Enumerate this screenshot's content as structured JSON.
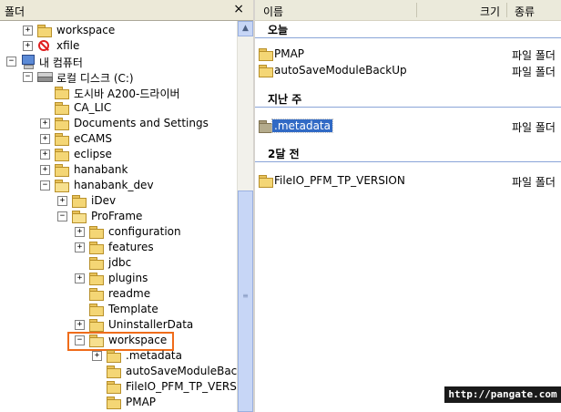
{
  "left_pane": {
    "title": "폴더",
    "close_glyph": "×",
    "tree": [
      {
        "label": "workspace",
        "expander": "+",
        "icon": "folder-icon"
      },
      {
        "label": "xfile",
        "expander": "+",
        "icon": "blocked-icon"
      },
      {
        "label": "내 컴퓨터",
        "expander": "−",
        "icon": "computer-icon"
      },
      {
        "label": "로컬 디스크 (C:)",
        "expander": "−",
        "icon": "drive-icon"
      },
      {
        "label": "도시바 A200-드라이버",
        "expander": "",
        "icon": "folder-icon"
      },
      {
        "label": "CA_LIC",
        "expander": "",
        "icon": "folder-icon"
      },
      {
        "label": "Documents and Settings",
        "expander": "+",
        "icon": "folder-icon"
      },
      {
        "label": "eCAMS",
        "expander": "+",
        "icon": "folder-icon"
      },
      {
        "label": "eclipse",
        "expander": "+",
        "icon": "folder-icon"
      },
      {
        "label": "hanabank",
        "expander": "+",
        "icon": "folder-icon"
      },
      {
        "label": "hanabank_dev",
        "expander": "−",
        "icon": "folder-icon"
      },
      {
        "label": "iDev",
        "expander": "+",
        "icon": "folder-icon"
      },
      {
        "label": "ProFrame",
        "expander": "−",
        "icon": "folder-icon"
      },
      {
        "label": "configuration",
        "expander": "+",
        "icon": "folder-icon"
      },
      {
        "label": "features",
        "expander": "+",
        "icon": "folder-icon"
      },
      {
        "label": "jdbc",
        "expander": "",
        "icon": "folder-icon"
      },
      {
        "label": "plugins",
        "expander": "+",
        "icon": "folder-icon"
      },
      {
        "label": "readme",
        "expander": "",
        "icon": "folder-icon"
      },
      {
        "label": "Template",
        "expander": "",
        "icon": "folder-icon"
      },
      {
        "label": "UninstallerData",
        "expander": "+",
        "icon": "folder-icon"
      },
      {
        "label": "workspace",
        "expander": "−",
        "icon": "folder-open-icon"
      },
      {
        "label": ".metadata",
        "expander": "+",
        "icon": "folder-icon"
      },
      {
        "label": "autoSaveModuleBack",
        "expander": "",
        "icon": "folder-icon"
      },
      {
        "label": "FileIO_PFM_TP_VERS",
        "expander": "",
        "icon": "folder-icon"
      },
      {
        "label": "PMAP",
        "expander": "",
        "icon": "folder-icon"
      }
    ],
    "scroll_up_glyph": "▲",
    "scroll_grip_glyph": "≡"
  },
  "right_pane": {
    "columns": {
      "name": "이름",
      "size": "크기",
      "type": "종류"
    },
    "groups": [
      {
        "title": "오늘",
        "items": [
          {
            "name": "PMAP",
            "type": "파일 폴더"
          },
          {
            "name": "autoSaveModuleBackUp",
            "type": "파일 폴더"
          }
        ]
      },
      {
        "title": "지난 주",
        "items": [
          {
            "name": ".metadata",
            "type": "파일 폴더"
          }
        ]
      },
      {
        "title": "2달 전",
        "items": [
          {
            "name": "FileIO_PFM_TP_VERSION",
            "type": "파일 폴더"
          }
        ]
      }
    ]
  },
  "watermark": "http://pangate.com",
  "colors": {
    "highlight_box": "#ef6c1a",
    "selection": "#316ac5",
    "folder": "#f4d675",
    "scrollbar": "#c7d6f6"
  }
}
